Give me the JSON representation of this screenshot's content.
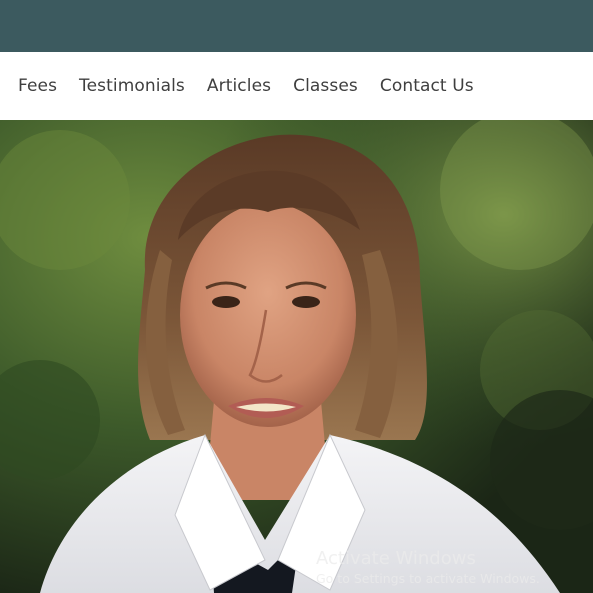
{
  "header": {
    "bar_color": "#3c5a5f"
  },
  "nav": {
    "items": [
      {
        "label": "Fees"
      },
      {
        "label": "Testimonials"
      },
      {
        "label": "Articles"
      },
      {
        "label": "Classes"
      },
      {
        "label": "Contact Us"
      }
    ]
  },
  "hero": {
    "image_icon": "portrait-photo"
  },
  "watermark": {
    "title": "Activate Windows",
    "subtitle": "Go to Settings to activate Windows."
  }
}
